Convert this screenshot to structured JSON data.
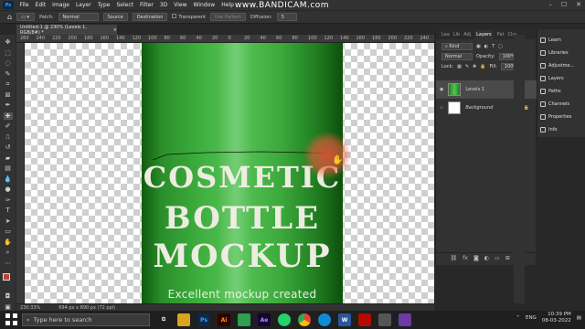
{
  "menu": {
    "items": [
      "File",
      "Edit",
      "Image",
      "Layer",
      "Type",
      "Select",
      "Filter",
      "3D",
      "View",
      "Window",
      "Help"
    ],
    "app_logo": "Ps"
  },
  "watermark": "www.BANDICAM.com",
  "options": {
    "patch_label": "Patch:",
    "patch_value": "Normal",
    "source_label": "Source",
    "destination_label": "Destination",
    "transparent_label": "Transparent",
    "use_pattern_label": "Use Pattern",
    "diffusion_label": "Diffusion:",
    "diffusion_value": "5"
  },
  "document": {
    "tab_title": "Untitled-1 @ 230% (Levels 1, RGB/8#) *",
    "close": "×"
  },
  "rulers": {
    "top_ticks": [
      "260",
      "240",
      "220",
      "200",
      "180",
      "160",
      "140",
      "120",
      "100",
      "80",
      "60",
      "40",
      "20",
      "0",
      "20",
      "40",
      "60",
      "80",
      "100",
      "120",
      "140",
      "160",
      "180",
      "200",
      "220",
      "240",
      "260"
    ]
  },
  "canvas": {
    "line1": "COSMETIC",
    "line2": "BOTTLE",
    "line3": "MOCKUP",
    "line4": "Excellent mockup created"
  },
  "status": {
    "zoom": "230.33%",
    "doc_size": "694 px x 890 px (72 ppi)"
  },
  "layers_panel": {
    "tabs": [
      "Lea",
      "Lib",
      "Adj",
      "Layers",
      "Pat",
      "Cha"
    ],
    "active_tab": "Layers",
    "kind_label": "Kind",
    "blend_mode": "Normal",
    "opacity_label": "Opacity:",
    "opacity_value": "100%",
    "lock_label": "Lock:",
    "fill_label": "Fill:",
    "fill_value": "100%",
    "layers": [
      {
        "name": "Levels 1",
        "selected": true
      },
      {
        "name": "Background",
        "selected": false
      }
    ]
  },
  "side_panel": {
    "items": [
      "Learn",
      "Libraries",
      "Adjustme...",
      "Layers",
      "Paths",
      "Channels",
      "Properties",
      "Info"
    ]
  },
  "taskbar": {
    "search_placeholder": "Type here to search",
    "lang": "ENG",
    "time": "10:39 PM",
    "date": "08-03-2022"
  },
  "colors": {
    "foreground": "#c0423a",
    "background": "#ffffff",
    "bottle_green": "#3fb03f"
  }
}
